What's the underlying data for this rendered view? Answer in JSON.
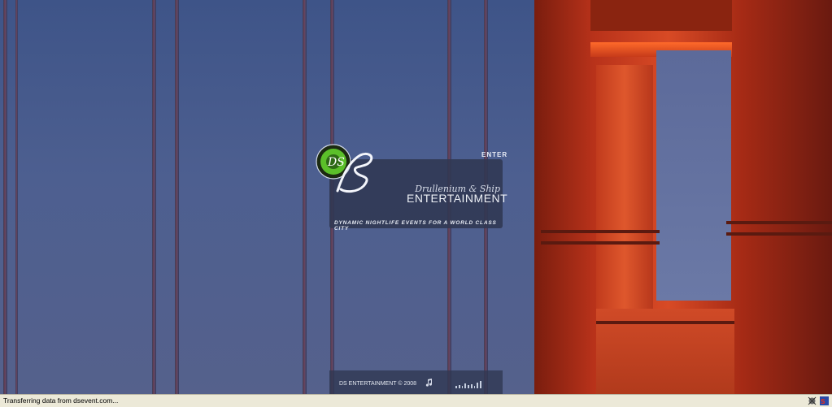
{
  "page": {
    "enter_label": "ENTER",
    "brand_script": "Drullenium & Ship",
    "brand_main": "ENTERTAINMENT",
    "tagline": "DYNAMIC NIGHTLIFE EVENTS FOR A WORLD CLASS CITY",
    "copyright": "DS ENTERTAINMENT © 2008",
    "logo_text": "DS"
  },
  "statusbar": {
    "text": "Transferring data from dsevent.com..."
  },
  "icons": [
    "logo-icon",
    "music-note-icon",
    "equalizer-icon",
    "popup-blocker-icon",
    "spyware-icon"
  ],
  "colors": {
    "sky": "#4a5d8e",
    "tower": "#c23c1d",
    "panel": "#303852",
    "logo_green": "#5bbf2a",
    "statusbar": "#ece9d8"
  }
}
